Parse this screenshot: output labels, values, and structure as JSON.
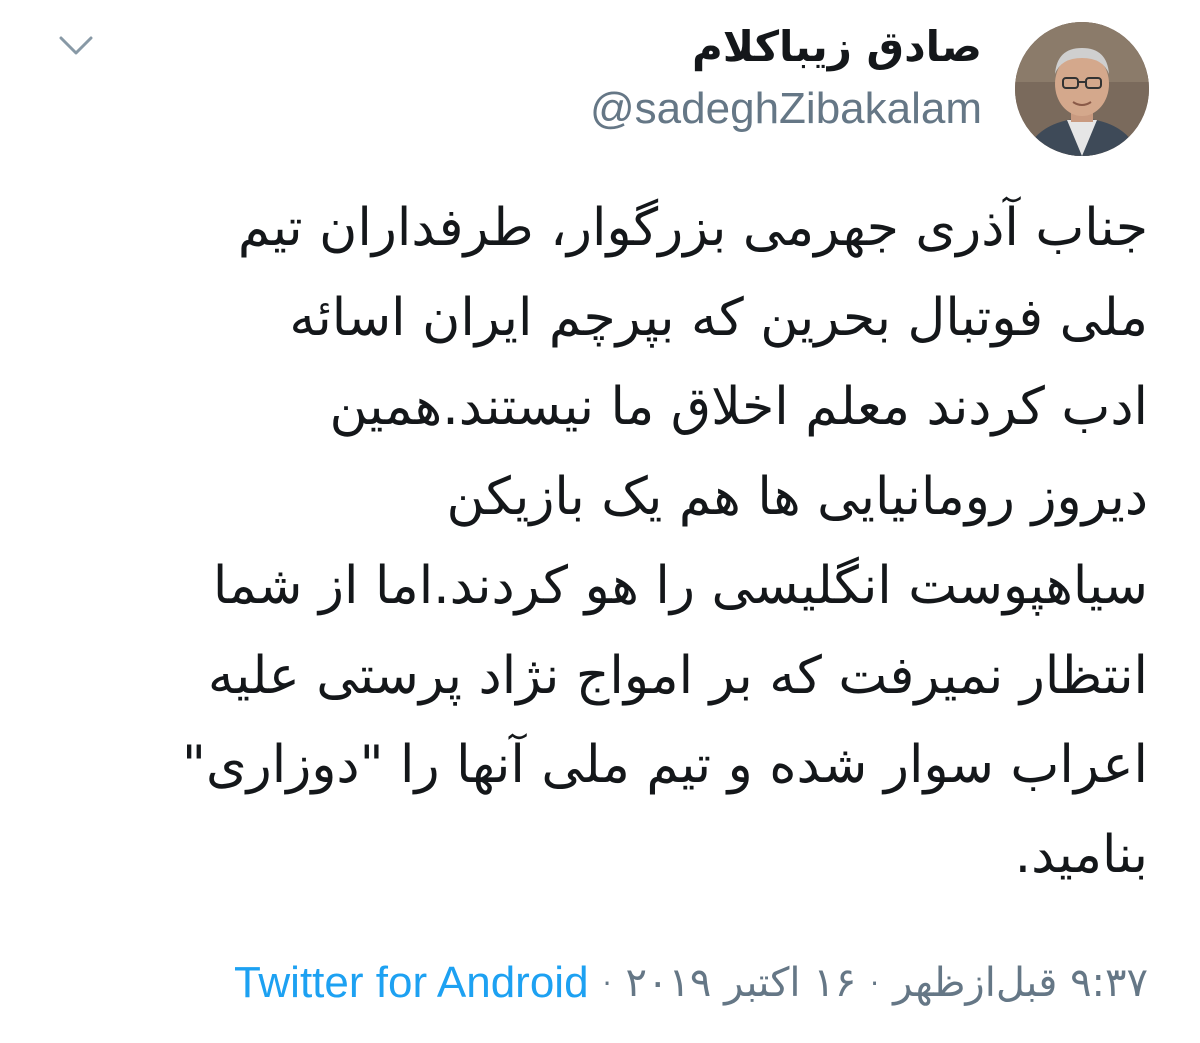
{
  "tweet": {
    "author_name": "صادق زیباکلام",
    "handle": "@sadeghZibakalam",
    "body_lines": [
      "جناب آذری جهرمی بزرگوار،    طرفداران تیم",
      "ملی فوتبال بحرین که بپرچم ایران اسائه",
      "ادب کردند معلم اخلاق ما نیستند.همین",
      "دیروز رومانیایی ها هم یک بازیکن",
      "سیاهپوست انگلیسی را هو کردند.اما از شما",
      "انتظار نمیرفت که بر امواج نژاد پرستی علیه",
      "اعراب سوار شده و تیم ملی آنها را \"دوزاری\"",
      "بنامید."
    ],
    "time": "۹:۳۷ قبل‌ازظهر",
    "date": "۱۶ اکتبر ۲۰۱۹",
    "separator": "·",
    "source": "Twitter for Android",
    "icons": {
      "menu": "chevron-down-icon",
      "avatar": "profile-photo"
    },
    "colors": {
      "text": "#14171a",
      "secondary": "#657786",
      "link": "#1da1f2"
    }
  }
}
